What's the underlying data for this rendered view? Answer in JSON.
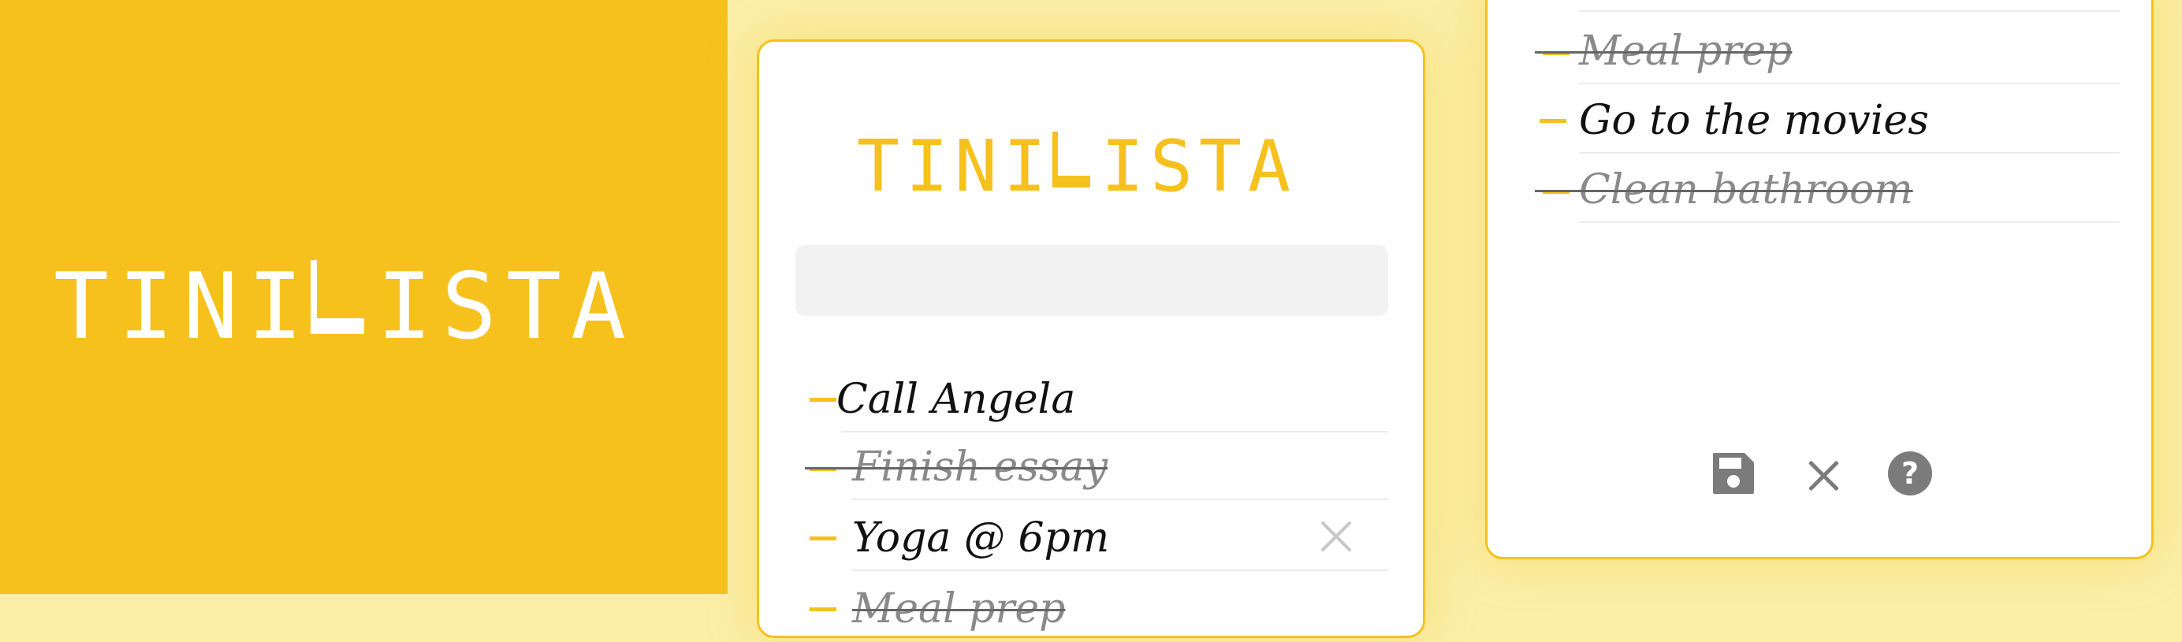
{
  "promo": {
    "logo_letters_left": [
      "T",
      "I",
      "N",
      "I"
    ],
    "logo_letters_right": [
      "I",
      "S",
      "T",
      "A"
    ]
  },
  "card1": {
    "logo_letters_left": [
      "T",
      "I",
      "N",
      "I"
    ],
    "logo_letters_right": [
      "I",
      "S",
      "T",
      "A"
    ],
    "new_task_value": "",
    "tasks": [
      {
        "label": "Call Angela",
        "done": false
      },
      {
        "label": "Finish essay",
        "done": true
      },
      {
        "label": "Yoga @ 6pm",
        "done": false
      },
      {
        "label": "Meal prep",
        "done": true
      }
    ]
  },
  "card2": {
    "tasks": [
      {
        "label": "Meal prep",
        "done": true
      },
      {
        "label": "Go to the movies",
        "done": false
      },
      {
        "label": "Clean bathroom",
        "done": true
      }
    ],
    "toolbar": {
      "save_icon": "save-icon",
      "close_icon": "close-icon",
      "help_icon": "help-icon"
    }
  },
  "colors": {
    "accent": "#f6c11d",
    "background": "#fbeea6",
    "done_text": "#8a8a8a"
  }
}
